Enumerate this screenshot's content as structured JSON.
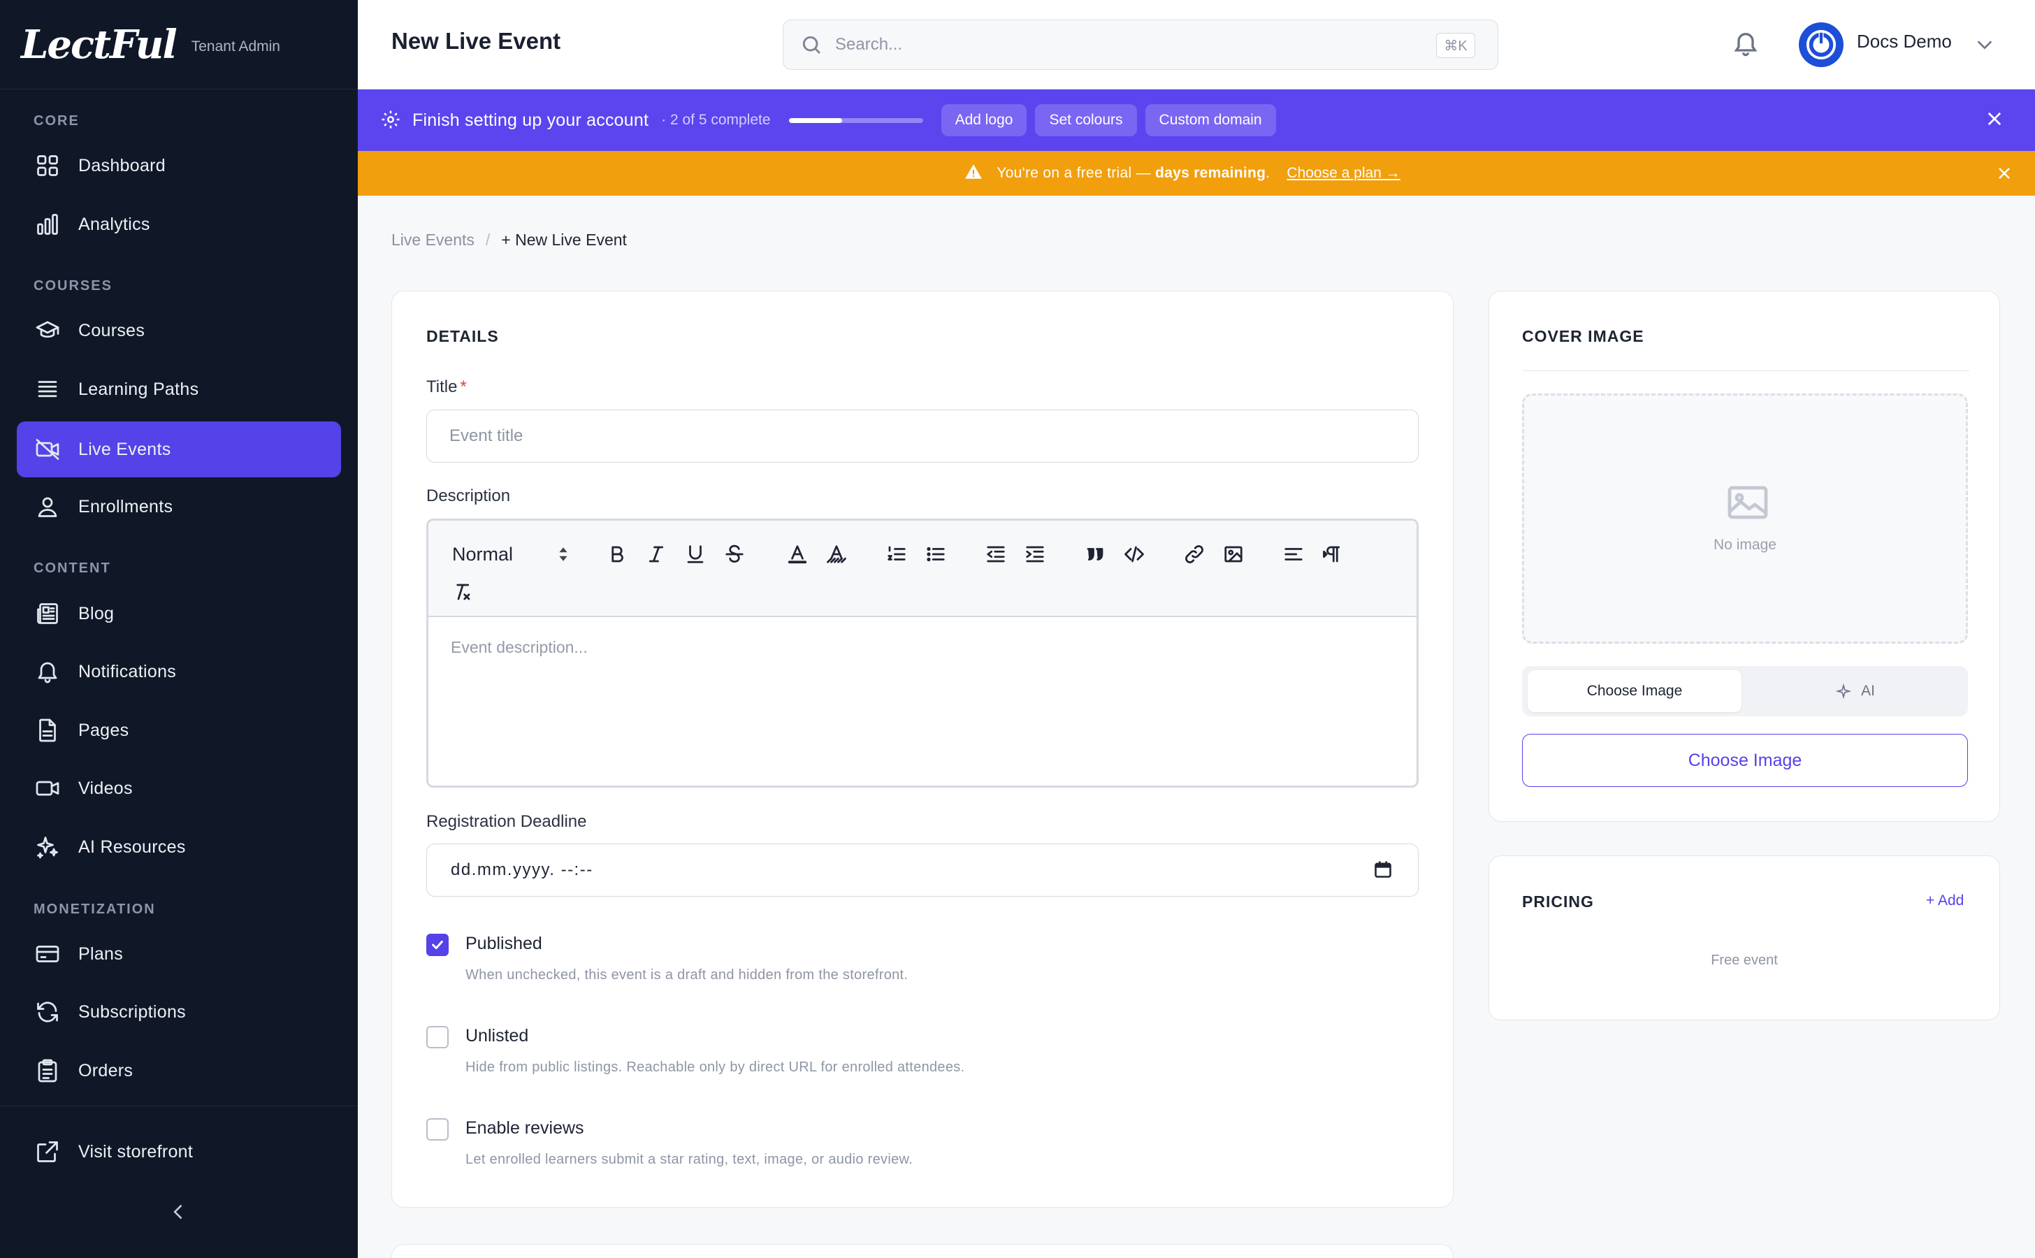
{
  "brand": {
    "logo": "LectFul",
    "subtitle": "Tenant Admin"
  },
  "sidebar": {
    "sections": [
      {
        "label": "CORE"
      },
      {
        "label": "COURSES"
      },
      {
        "label": "CONTENT"
      },
      {
        "label": "MONETIZATION"
      }
    ],
    "items": [
      {
        "label": "Dashboard",
        "icon": "dashboard-grid-icon"
      },
      {
        "label": "Analytics",
        "icon": "bar-chart-icon"
      },
      {
        "label": "Courses",
        "icon": "graduation-cap-icon"
      },
      {
        "label": "Learning Paths",
        "icon": "list-lines-icon"
      },
      {
        "label": "Live Events",
        "icon": "video-off-icon",
        "active": true
      },
      {
        "label": "Enrollments",
        "icon": "user-icon"
      },
      {
        "label": "Blog",
        "icon": "newspaper-icon"
      },
      {
        "label": "Notifications",
        "icon": "bell-icon"
      },
      {
        "label": "Pages",
        "icon": "file-icon"
      },
      {
        "label": "Videos",
        "icon": "video-camera-icon"
      },
      {
        "label": "AI Resources",
        "icon": "sparkles-icon"
      },
      {
        "label": "Plans",
        "icon": "credit-card-icon"
      },
      {
        "label": "Subscriptions",
        "icon": "refresh-icon"
      },
      {
        "label": "Orders",
        "icon": "clipboard-icon"
      }
    ],
    "footer": {
      "label": "Visit storefront",
      "icon": "external-link-icon"
    }
  },
  "topbar": {
    "title": "New Live Event",
    "search_placeholder": "Search...",
    "search_shortcut": "⌘K",
    "user_name": "Docs Demo"
  },
  "setup_banner": {
    "text": "Finish setting up your account",
    "progress_text": "· 2 of 5 complete",
    "progress_completed": 2,
    "progress_total": 5,
    "chips": [
      "Add logo",
      "Set colours",
      "Custom domain"
    ]
  },
  "trial_banner": {
    "text_prefix": "You're on a free trial — ",
    "text_bold": "days remaining",
    "text_suffix": ".",
    "link": "Choose a plan →"
  },
  "breadcrumb": {
    "parent": "Live Events",
    "separator": "/",
    "current": "+ New Live Event"
  },
  "details": {
    "heading": "DETAILS",
    "title_label": "Title",
    "title_required": "*",
    "title_placeholder": "Event title",
    "description_label": "Description",
    "editor_format": "Normal",
    "description_placeholder": "Event description...",
    "deadline_label": "Registration Deadline",
    "deadline_value": "dd.mm.yyyy. --:--",
    "published": {
      "label": "Published",
      "checked": true,
      "help": "When unchecked, this event is a draft and hidden from the storefront."
    },
    "unlisted": {
      "label": "Unlisted",
      "checked": false,
      "help": "Hide from public listings. Reachable only by direct URL for enrolled attendees."
    },
    "reviews": {
      "label": "Enable reviews",
      "checked": false,
      "help": "Let enrolled learners submit a star rating, text, image, or audio review."
    }
  },
  "cover": {
    "heading": "COVER IMAGE",
    "empty_text": "No image",
    "tab_choose": "Choose Image",
    "tab_ai": "AI",
    "button": "Choose Image"
  },
  "pricing": {
    "heading": "PRICING",
    "add": "+ Add",
    "empty": "Free event"
  },
  "colors": {
    "accent": "#5542e8",
    "sidebar_bg": "#101828",
    "setup_banner": "#5b45ee",
    "trial_banner": "#f29f0d"
  }
}
